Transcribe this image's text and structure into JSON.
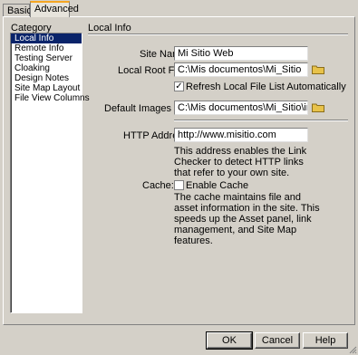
{
  "tabs": {
    "basic": "Basic",
    "advanced": "Advanced"
  },
  "category": {
    "heading": "Category",
    "items": [
      "Local Info",
      "Remote Info",
      "Testing Server",
      "Cloaking",
      "Design Notes",
      "Site Map Layout",
      "File View Columns"
    ]
  },
  "section_title": "Local Info",
  "form": {
    "site_name_label": "Site Name:",
    "site_name_value": "Mi Sitio Web",
    "local_root_label": "Local Root Folder:",
    "local_root_value": "C:\\Mis documentos\\Mi_Sitio",
    "refresh_label": "Refresh Local File List Automatically",
    "refresh_checked": "✓",
    "default_images_label": "Default Images Folder:",
    "default_images_value": "C:\\Mis documentos\\Mi_Sitio\\imagenes",
    "http_label": "HTTP Address:",
    "http_value": "http://www.misitio.com",
    "http_desc": "This address enables the Link Checker to detect HTTP links that refer to your own site.",
    "cache_label": "Cache:",
    "enable_cache_label": "Enable Cache",
    "cache_desc": "The cache maintains file and asset information in the site.  This speeds up the Asset panel, link management, and Site Map features."
  },
  "buttons": {
    "ok": "OK",
    "cancel": "Cancel",
    "help": "Help"
  },
  "colors": {
    "selection": "#0a246a",
    "tab_accent": "#f5a623",
    "folder": "#e8c24a"
  }
}
